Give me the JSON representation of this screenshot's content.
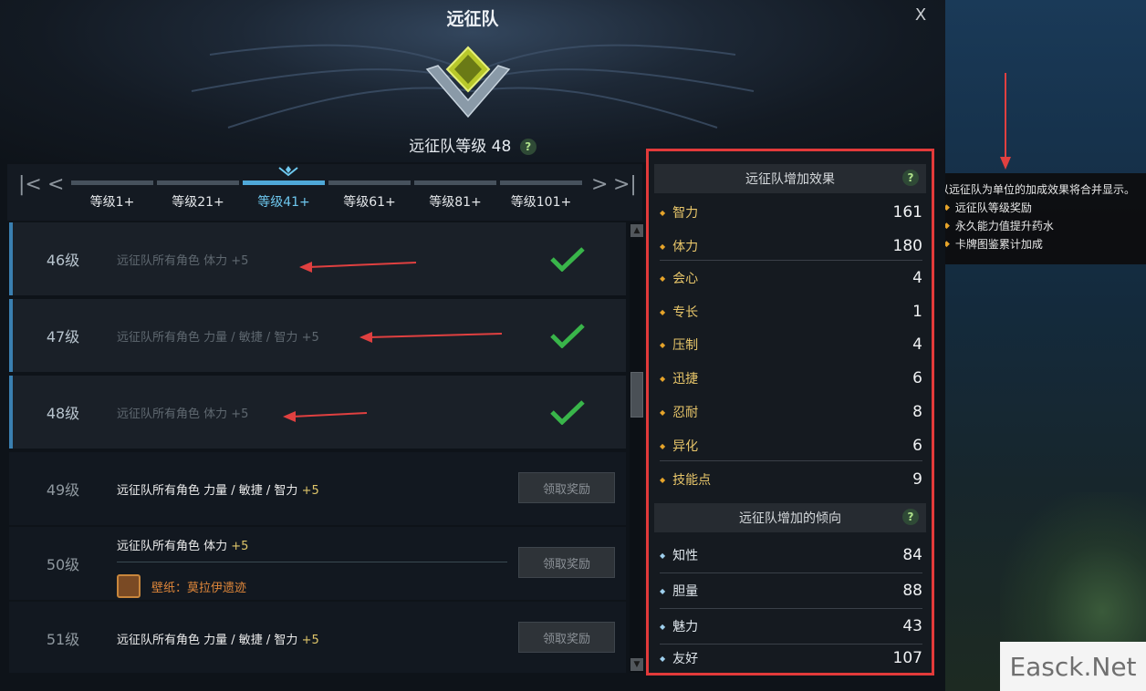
{
  "header": {
    "title": "远征队",
    "close_label": "X",
    "level_text": "远征队等级 48",
    "help_label": "?"
  },
  "tabs": {
    "items": [
      {
        "label": "等级1+"
      },
      {
        "label": "等级21+"
      },
      {
        "label": "等级41+",
        "active": true
      },
      {
        "label": "等级61+"
      },
      {
        "label": "等级81+"
      },
      {
        "label": "等级101+"
      }
    ]
  },
  "rows": [
    {
      "level": "46级",
      "desc": "远征队所有角色 体力",
      "bonus": "+5",
      "done": true
    },
    {
      "level": "47级",
      "desc": "远征队所有角色 力量 / 敏捷 / 智力",
      "bonus": "+5",
      "done": true
    },
    {
      "level": "48级",
      "desc": "远征队所有角色 体力",
      "bonus": "+5",
      "done": true
    },
    {
      "level": "49级",
      "desc": "远征队所有角色 力量 / 敏捷 / 智力",
      "bonus": "+5",
      "button": "领取奖励"
    },
    {
      "level": "50级",
      "desc": "远征队所有角色 体力",
      "bonus": "+5",
      "reward": "壁纸：莫拉伊遗迹",
      "button": "领取奖励"
    },
    {
      "level": "51级",
      "desc": "远征队所有角色 力量 / 敏捷 / 智力",
      "bonus": "+5",
      "button": "领取奖励"
    }
  ],
  "stats": {
    "bonus_title": "远征队增加效果",
    "bonus_items": [
      {
        "name": "智力",
        "value": "161"
      },
      {
        "name": "体力",
        "value": "180"
      },
      {
        "name": "会心",
        "value": "4"
      },
      {
        "name": "专长",
        "value": "1"
      },
      {
        "name": "压制",
        "value": "4"
      },
      {
        "name": "迅捷",
        "value": "6"
      },
      {
        "name": "忍耐",
        "value": "8"
      },
      {
        "name": "异化",
        "value": "6"
      },
      {
        "name": "技能点",
        "value": "9"
      }
    ],
    "tendency_title": "远征队增加的倾向",
    "tendency_items": [
      {
        "name": "知性",
        "value": "84"
      },
      {
        "name": "胆量",
        "value": "88"
      },
      {
        "name": "魅力",
        "value": "43"
      },
      {
        "name": "友好",
        "value": "107"
      }
    ]
  },
  "tooltip": {
    "title": "以远征队为单位的加成效果将合并显示。",
    "items": [
      "远征队等级奖励",
      "永久能力值提升药水",
      "卡牌图鉴累计加成"
    ]
  },
  "watermark": "Easck.Net",
  "colors": {
    "accent": "#4fa8d8",
    "highlight_border": "#e23a3a",
    "stat_gold": "#e8c66a",
    "check_green": "#39b54a",
    "annotation_arrow": "#e04040"
  }
}
